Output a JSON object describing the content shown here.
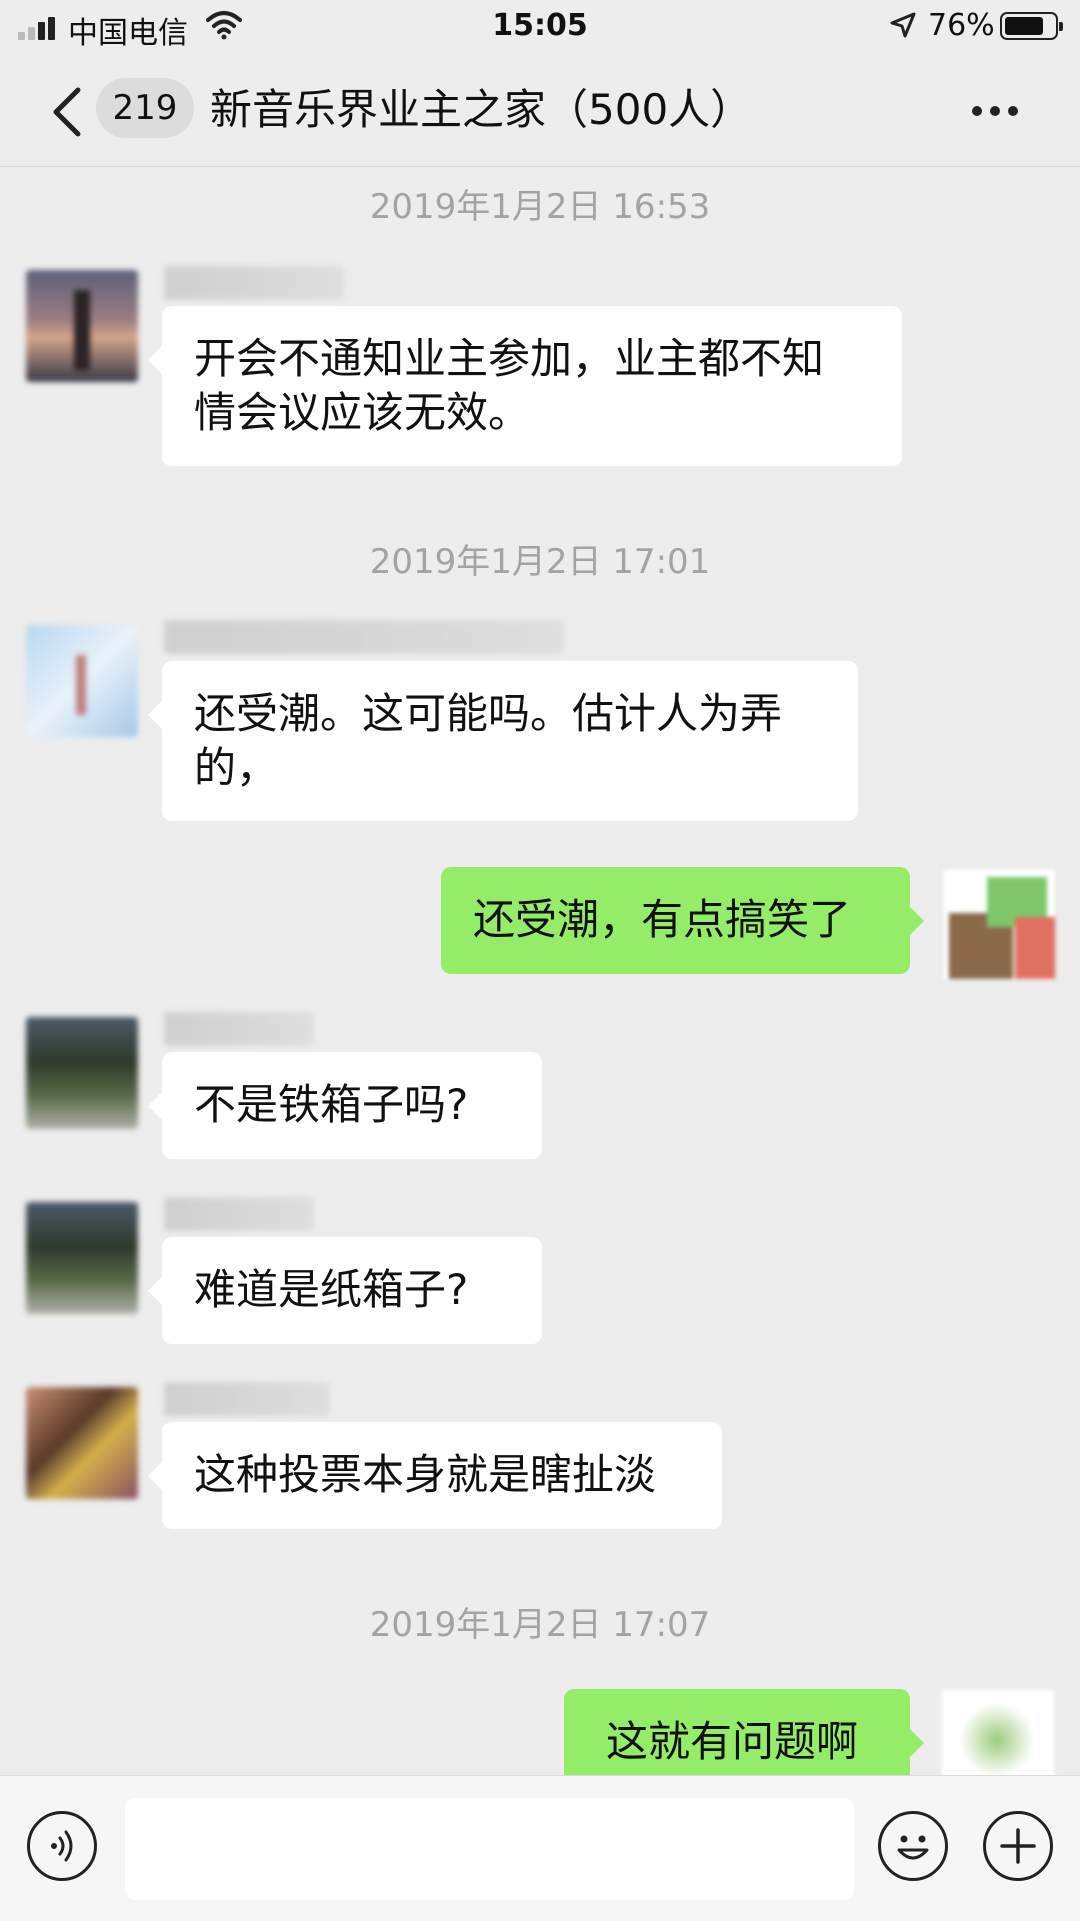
{
  "status_bar": {
    "carrier": "中国电信",
    "time": "15:05",
    "battery_percent": "76%",
    "battery_level": 0.76,
    "icons": [
      "signal-icon",
      "wifi-icon",
      "location-icon",
      "battery-icon"
    ]
  },
  "nav": {
    "back_icon": "chevron-left-icon",
    "unread_count": "219",
    "title": "新音乐界业主之家（500人）",
    "more_icon": "more-dots-icon"
  },
  "chat": {
    "timestamps": [
      "2019年1月2日 16:53",
      "2019年1月2日 17:01",
      "2019年1月2日 17:07"
    ],
    "messages": [
      {
        "side": "left",
        "sender": "8-",
        "text": "开会不通知业主参加，业主都不知\n情会议应该无效。"
      },
      {
        "side": "left",
        "sender": "4-",
        "text": "还受潮。这可能吗。估计人为弄\n的，"
      },
      {
        "side": "right",
        "text": "还受潮，有点搞笑了"
      },
      {
        "side": "left",
        "sender": "",
        "text": "不是铁箱子吗?"
      },
      {
        "side": "left",
        "sender": "",
        "text": "难道是纸箱子?"
      },
      {
        "side": "left",
        "sender": "",
        "text": "这种投票本身就是瞎扯淡"
      },
      {
        "side": "right",
        "text": "这就有问题啊"
      }
    ]
  },
  "input_bar": {
    "voice_icon": "voice-icon",
    "emoji_icon": "emoji-icon",
    "add_icon": "plus-icon",
    "placeholder": ""
  },
  "colors": {
    "background": "#ededed",
    "incoming_bubble": "#ffffff",
    "outgoing_bubble": "#95ec69",
    "timestamp": "#a3a3a3"
  }
}
